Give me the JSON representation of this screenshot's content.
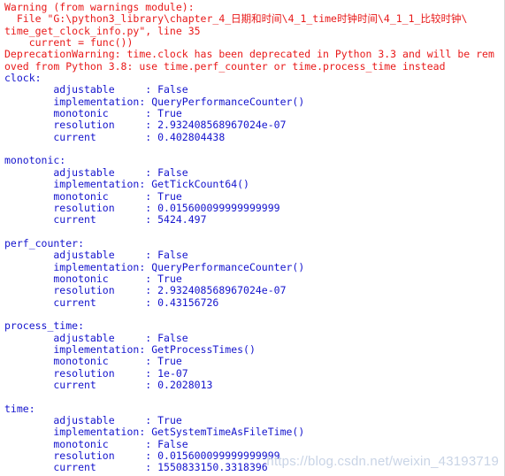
{
  "colors": {
    "warning_text": "#e81919",
    "output_text": "#1414cd",
    "background": "#ffffff",
    "watermark": "#c9d4e6"
  },
  "warning_block": {
    "header": "Warning (from warnings module):",
    "file_line": "  File \"G:\\python3_library\\chapter_4_日期和时间\\4_1_time时钟时间\\4_1_1_比较时钟\\",
    "file_line_cont": "time_get_clock_info.py\", line 35",
    "source_line": "    current = func())",
    "message_line_1": "DeprecationWarning: time.clock has been deprecated in Python 3.3 and will be rem",
    "message_line_2": "oved from Python 3.8: use time.perf_counter or time.process_time instead"
  },
  "clocks": [
    {
      "name": "clock:",
      "fields": [
        {
          "key": "adjustable",
          "sep": "     : ",
          "value": "False"
        },
        {
          "key": "implementation",
          "sep": ": ",
          "value": "QueryPerformanceCounter()"
        },
        {
          "key": "monotonic",
          "sep": "      : ",
          "value": "True"
        },
        {
          "key": "resolution",
          "sep": "     : ",
          "value": "2.932408568967024e-07"
        },
        {
          "key": "current",
          "sep": "        : ",
          "value": "0.402804438"
        }
      ]
    },
    {
      "name": "monotonic:",
      "fields": [
        {
          "key": "adjustable",
          "sep": "     : ",
          "value": "False"
        },
        {
          "key": "implementation",
          "sep": ": ",
          "value": "GetTickCount64()"
        },
        {
          "key": "monotonic",
          "sep": "      : ",
          "value": "True"
        },
        {
          "key": "resolution",
          "sep": "     : ",
          "value": "0.015600099999999999"
        },
        {
          "key": "current",
          "sep": "        : ",
          "value": "5424.497"
        }
      ]
    },
    {
      "name": "perf_counter:",
      "fields": [
        {
          "key": "adjustable",
          "sep": "     : ",
          "value": "False"
        },
        {
          "key": "implementation",
          "sep": ": ",
          "value": "QueryPerformanceCounter()"
        },
        {
          "key": "monotonic",
          "sep": "      : ",
          "value": "True"
        },
        {
          "key": "resolution",
          "sep": "     : ",
          "value": "2.932408568967024e-07"
        },
        {
          "key": "current",
          "sep": "        : ",
          "value": "0.43156726"
        }
      ]
    },
    {
      "name": "process_time:",
      "fields": [
        {
          "key": "adjustable",
          "sep": "     : ",
          "value": "False"
        },
        {
          "key": "implementation",
          "sep": ": ",
          "value": "GetProcessTimes()"
        },
        {
          "key": "monotonic",
          "sep": "      : ",
          "value": "True"
        },
        {
          "key": "resolution",
          "sep": "     : ",
          "value": "1e-07"
        },
        {
          "key": "current",
          "sep": "        : ",
          "value": "0.2028013"
        }
      ]
    },
    {
      "name": "time:",
      "fields": [
        {
          "key": "adjustable",
          "sep": "     : ",
          "value": "True"
        },
        {
          "key": "implementation",
          "sep": ": ",
          "value": "GetSystemTimeAsFileTime()"
        },
        {
          "key": "monotonic",
          "sep": "      : ",
          "value": "False"
        },
        {
          "key": "resolution",
          "sep": "     : ",
          "value": "0.015600099999999999"
        },
        {
          "key": "current",
          "sep": "        : ",
          "value": "1550833150.3318396"
        }
      ]
    }
  ],
  "field_indent": "        ",
  "watermark": "https://blog.csdn.net/weixin_43193719"
}
